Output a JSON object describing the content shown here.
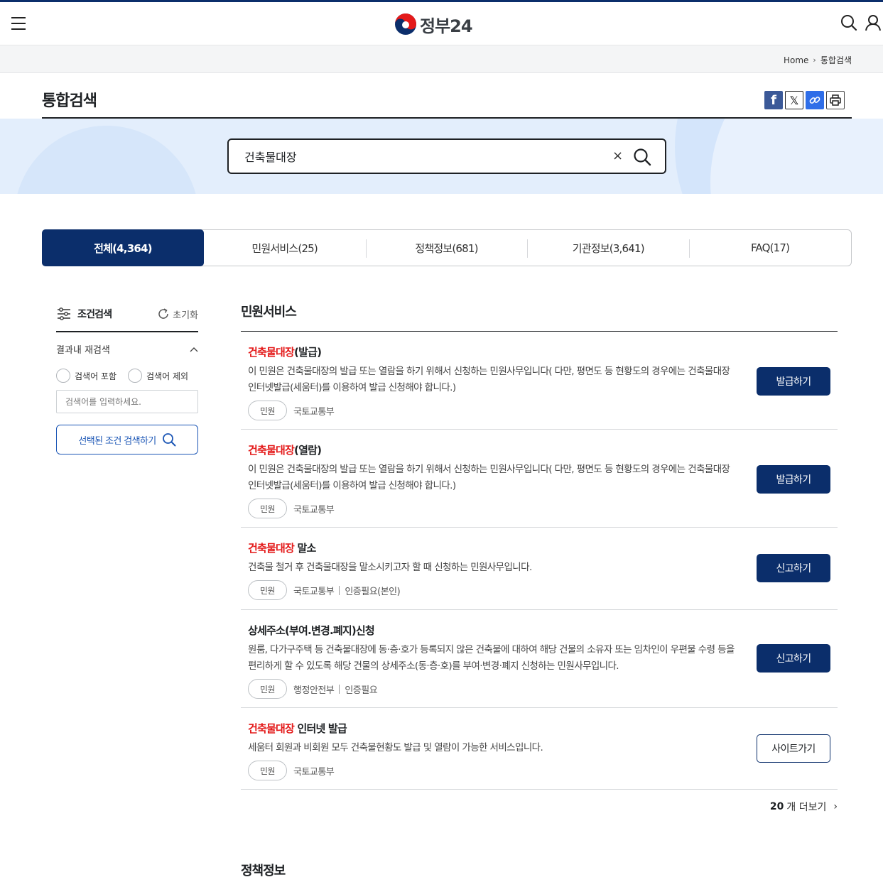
{
  "header": {
    "logo_text": "정부24",
    "menu_icon": "hamburger-icon",
    "search_icon": "search-icon",
    "user_icon": "user-icon"
  },
  "breadcrumb": {
    "home": "Home",
    "current": "통합검색"
  },
  "page": {
    "title": "통합검색"
  },
  "share": {
    "facebook": "f",
    "x": "𝕏"
  },
  "search": {
    "value": "건축물대장",
    "clear": "×"
  },
  "tabs": [
    {
      "label": "전체(4,364)",
      "active": true
    },
    {
      "label": "민원서비스(25)",
      "active": false
    },
    {
      "label": "정책정보(681)",
      "active": false
    },
    {
      "label": "기관정보(3,641)",
      "active": false
    },
    {
      "label": "FAQ(17)",
      "active": false
    }
  ],
  "sidebar": {
    "title": "조건검색",
    "reset": "초기화",
    "research_title": "결과내 재검색",
    "include_label": "검색어 포함",
    "exclude_label": "검색어 제외",
    "input_placeholder": "검색어를 입력하세요.",
    "search_button": "선택된 조건 검색하기"
  },
  "sections": {
    "civil": {
      "title": "민원서비스",
      "items": [
        {
          "title_hl": "건축물대장",
          "title_rest": "(발급)",
          "desc": "이 민원은 건축물대장의 발급 또는 열람을 하기 위해서 신청하는 민원사무입니다( 다만, 평면도 등 현황도의 경우에는 건축물대장 인터넷발급(세움터)를 이용하여 발급 신청해야 합니다.)",
          "tag": "민원",
          "agency": "국토교통부",
          "extra": "",
          "button": "발급하기"
        },
        {
          "title_hl": "건축물대장",
          "title_rest": "(열람)",
          "desc": "이 민원은 건축물대장의 발급 또는 열람을 하기 위해서 신청하는 민원사무입니다( 다만, 평면도 등 현황도의 경우에는 건축물대장 인터넷발급(세움터)를 이용하여 발급 신청해야 합니다.)",
          "tag": "민원",
          "agency": "국토교통부",
          "extra": "",
          "button": "발급하기"
        },
        {
          "title_hl": "건축물대장",
          "title_rest": " 말소",
          "desc": "건축물 철거 후 건축물대장을 말소시키고자 할 때 신청하는 민원사무입니다.",
          "tag": "민원",
          "agency": "국토교통부",
          "extra": "인증필요(본인)",
          "button": "신고하기"
        },
        {
          "title_hl": "",
          "title_rest": "상세주소(부여.변경.폐지)신청",
          "desc": "원룸, 다가구주택 등 건축물대장에 동·층·호가 등록되지 않은 건축물에 대하여 해당 건물의 소유자 또는 임차인이 우편물 수령 등을 편리하게 할 수 있도록 해당 건물의 상세주소(동·층·호)를 부여·변경·폐지 신청하는 민원사무입니다.",
          "tag": "민원",
          "agency": "행정안전부",
          "extra": "인증필요",
          "button": "신고하기"
        },
        {
          "title_hl": "건축물대장",
          "title_rest": " 인터넷 발급",
          "desc": "세움터 회원과 비회원 모두 건축물현황도 발급 및 열람이 가능한 서비스입니다.",
          "tag": "민원",
          "agency": "국토교통부",
          "extra": "",
          "button": "사이트가기"
        }
      ],
      "more_count": "20",
      "more_label": "개 더보기"
    },
    "policy": {
      "title": "정책정보"
    }
  },
  "colors": {
    "navy": "#0b2e6b",
    "highlight": "#e41a1a",
    "band": "#e3eefc"
  }
}
